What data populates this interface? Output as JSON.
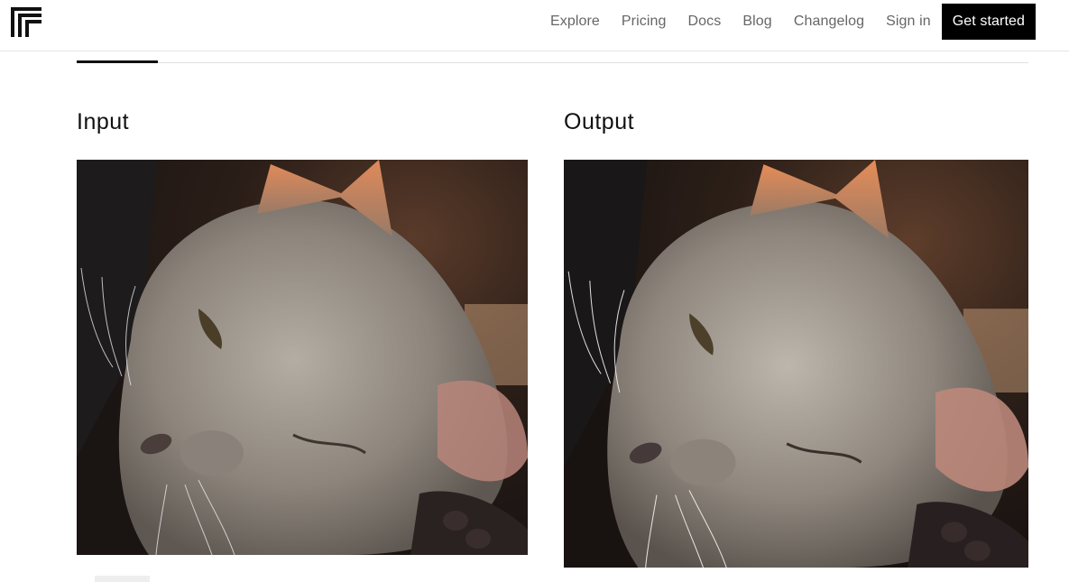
{
  "header": {
    "logo_icon": "replicate-logo-icon",
    "nav": {
      "explore": "Explore",
      "pricing": "Pricing",
      "docs": "Docs",
      "blog": "Blog",
      "changelog": "Changelog",
      "sign_in": "Sign in",
      "get_started": "Get started"
    }
  },
  "main": {
    "input_title": "Input",
    "output_title": "Output",
    "input_image_alt": "cat-photo",
    "output_image_alt": "cat-photo-upscaled"
  },
  "colors": {
    "accent": "#000000",
    "nav_text": "#666666"
  }
}
